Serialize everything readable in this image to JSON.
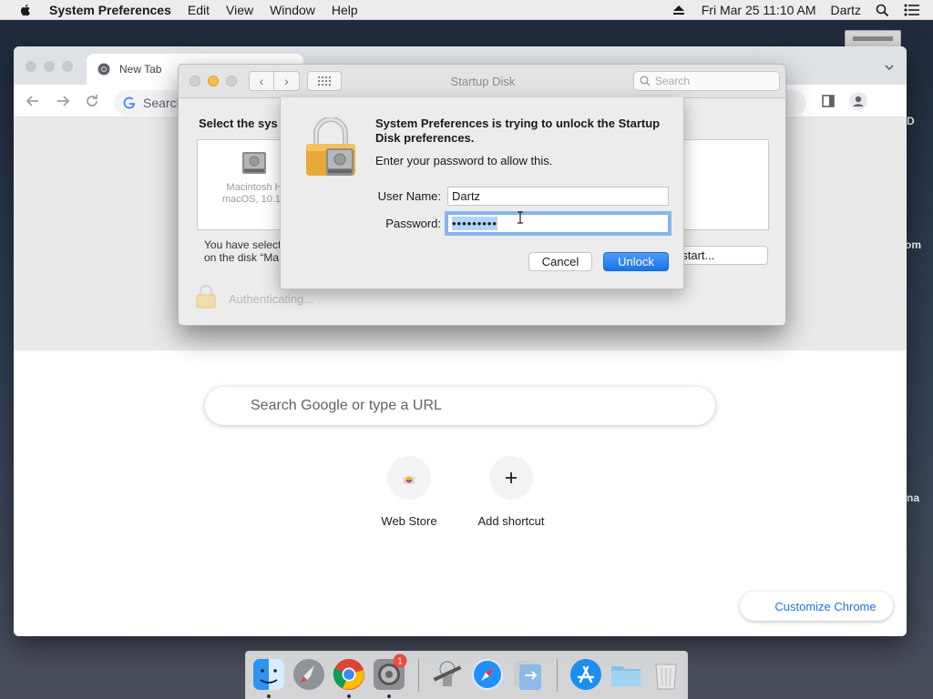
{
  "menubar": {
    "app": "System Preferences",
    "items": [
      "Edit",
      "View",
      "Window",
      "Help"
    ],
    "clock": "Fri Mar 25  11:10 AM",
    "user": "Dartz"
  },
  "desktop_edge": {
    "labels": [
      "D",
      "om",
      "na"
    ]
  },
  "chrome": {
    "tab_title": "New Tab",
    "omnibox_text": "Search",
    "search_placeholder": "Search Google or type a URL",
    "shortcuts": [
      {
        "label": "Web Store",
        "icon": "chrome-web-store-icon"
      },
      {
        "label": "Add shortcut",
        "icon": "plus-icon"
      }
    ],
    "customize_label": "Customize Chrome"
  },
  "sysprefs": {
    "window_title": "Startup Disk",
    "search_placeholder": "Search",
    "select_label": "Select the sys",
    "disk_name_line1": "Macintosh H",
    "disk_name_line2": "macOS, 10.14",
    "selected_text_line1": "You have selecte",
    "selected_text_line2": "on the disk “Ma",
    "restart_label": "estart...",
    "auth_status": "Authenticating..."
  },
  "auth_sheet": {
    "title": "System Preferences is trying to unlock the Startup Disk preferences.",
    "subtitle": "Enter your password to allow this.",
    "username_label": "User Name:",
    "username_value": "Dartz",
    "password_label": "Password:",
    "password_value": "•••••••••",
    "cancel_label": "Cancel",
    "unlock_label": "Unlock"
  },
  "dock": {
    "apps": [
      "Finder",
      "Launchpad",
      "Google Chrome",
      "System Preferences",
      "Automator",
      "Safari",
      "Migration Assistant",
      "App Store",
      "Folder",
      "Trash"
    ],
    "badge_count": "1"
  },
  "colors": {
    "accent_blue": "#1874e8",
    "focus_ring": "#8ab6ec",
    "lock_gold": "#e9a93a",
    "customize_link": "#1a73e8"
  }
}
